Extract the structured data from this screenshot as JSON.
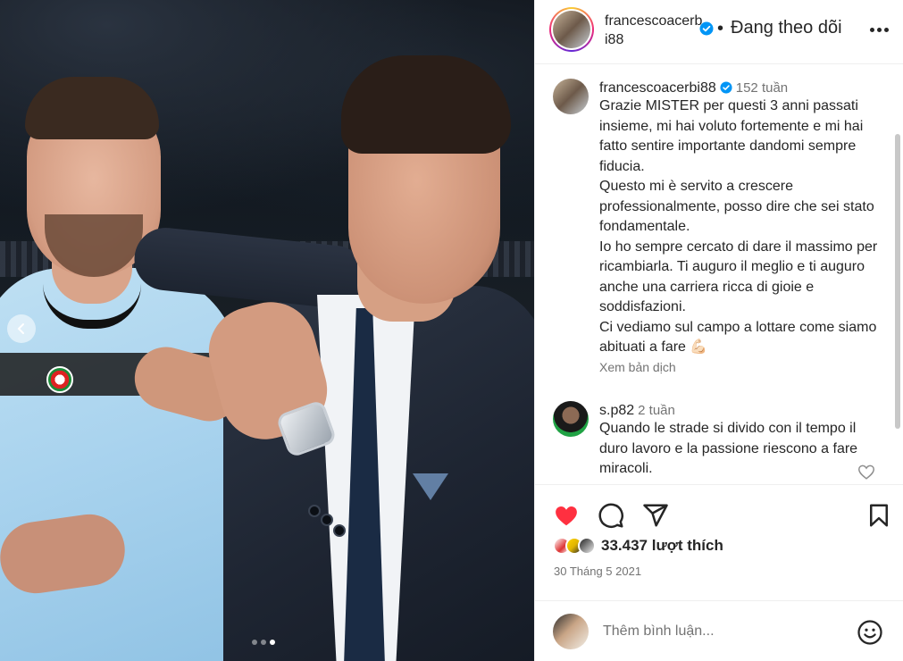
{
  "post": {
    "username": "francescoacerbi88",
    "follow_status": "Đang theo dõi",
    "separator": "•"
  },
  "caption": {
    "username": "francescoacerbi88",
    "time": "152 tuần",
    "text": "Grazie MISTER per questi 3 anni passati insieme, mi hai voluto fortemente e mi hai fatto sentire importante dandomi sempre fiducia.\nQuesto mi è servito a crescere professionalmente, posso dire che sei stato fondamentale.\nIo ho sempre cercato di dare il massimo per ricambiarla. Ti auguro il meglio e ti auguro anche una carriera ricca di gioie e soddisfazioni.\nCi vediamo sul campo a lottare come siamo abituati a fare 💪🏻",
    "translate_label": "Xem bản dịch"
  },
  "comments": [
    {
      "username": "s.p82",
      "time": "2 tuần",
      "text": "Quando le strade si divido con il tempo il duro lavoro e la passione riescono a fare miracoli."
    }
  ],
  "stats": {
    "likes": "33.437 lượt thích",
    "date": "30 Tháng 5 2021"
  },
  "add_comment": {
    "placeholder": "Thêm bình luận..."
  },
  "colors": {
    "like_red": "#ff3040",
    "verified_blue": "#0095f6",
    "text_secondary": "#737373"
  },
  "carousel": {
    "current": 3,
    "total": 3
  }
}
